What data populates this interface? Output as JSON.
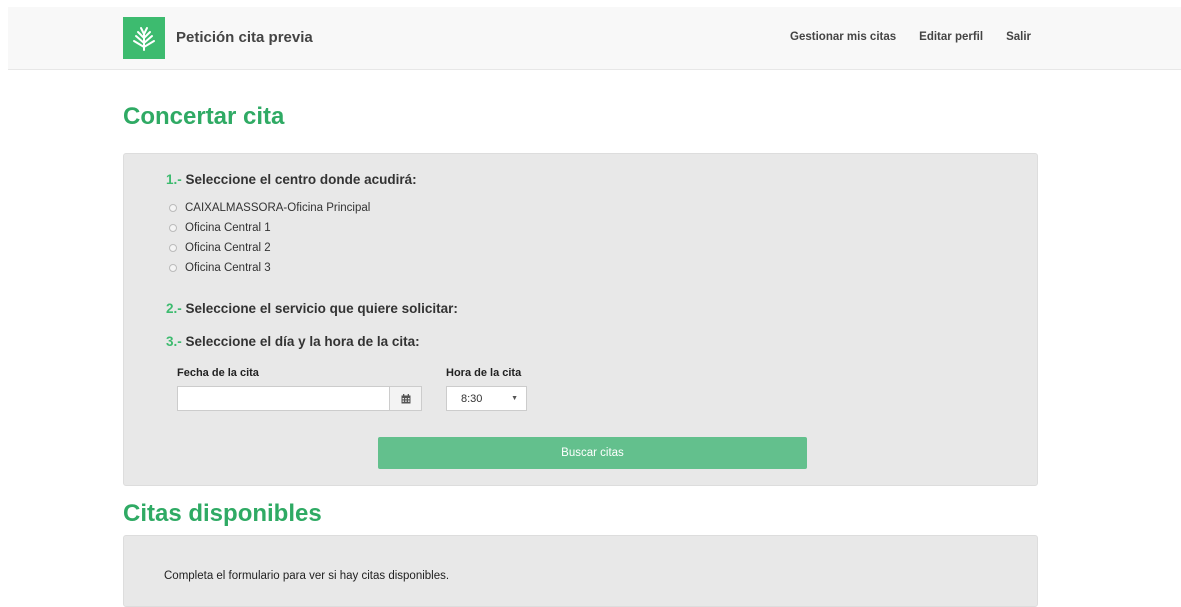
{
  "header": {
    "title": "Petición cita previa",
    "logo_icon": "wheat-logo-icon",
    "nav": [
      "Gestionar mis citas",
      "Editar perfil",
      "Salir"
    ]
  },
  "form": {
    "title": "Concertar cita",
    "step1": {
      "num": "1.-",
      "label": "Seleccione el centro donde acudirá:"
    },
    "centers": [
      "CAIXALMASSORA-Oficina Principal",
      "Oficina Central 1",
      "Oficina Central 2",
      "Oficina Central 3"
    ],
    "step2": {
      "num": "2.-",
      "label": "Seleccione el servicio que quiere solicitar:"
    },
    "step3": {
      "num": "3.-",
      "label": "Seleccione el día y la hora de la cita:"
    },
    "date_label": "Fecha de la cita",
    "date_value": "",
    "time_label": "Hora de la cita",
    "time_value": "8:30",
    "search_button": "Buscar citas"
  },
  "results": {
    "title": "Citas disponibles",
    "message": "Completa el formulario para ver si hay citas disponibles."
  },
  "colors": {
    "accent": "#3dbb6f",
    "button": "#63c08d",
    "panel": "#e8e8e8"
  }
}
